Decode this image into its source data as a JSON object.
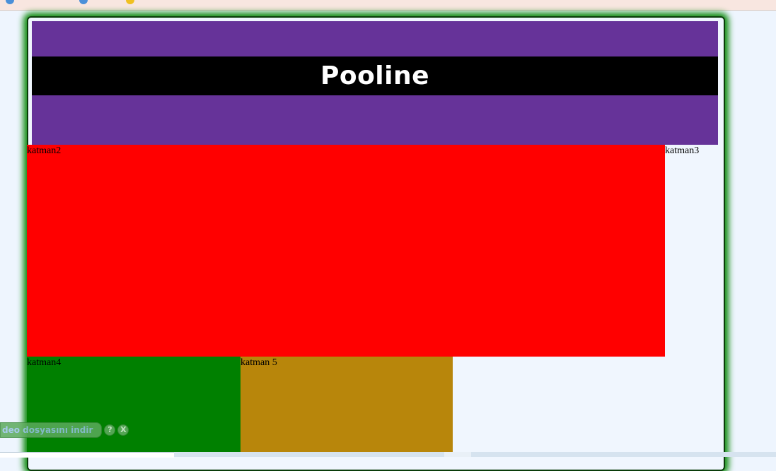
{
  "header": {
    "title": "Pooline"
  },
  "layers": {
    "katman2": "katman2",
    "katman3": "katman3",
    "katman4": "katman4",
    "katman5": "katman 5"
  },
  "video_toolbar": {
    "label": "deo dosyasını indir",
    "help_icon_glyph": "?",
    "close_icon_glyph": "X"
  },
  "colors": {
    "header_bg": "#663399",
    "title_band": "#000000",
    "katman2_bg": "#ff0000",
    "katman4_bg": "#008000",
    "katman5_bg": "#b8860b",
    "frame_glow": "#0e8a0e"
  }
}
